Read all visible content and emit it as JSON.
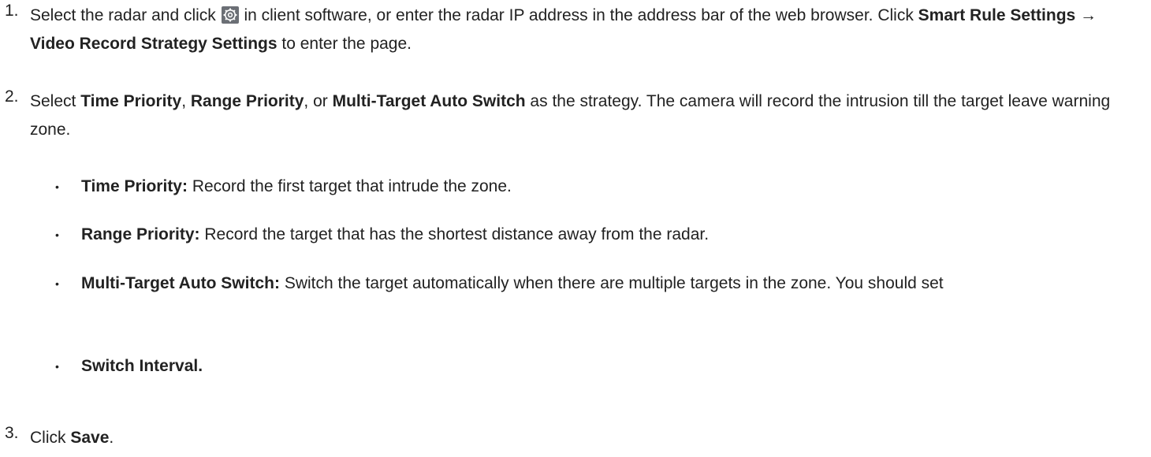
{
  "steps": [
    {
      "number": "1.",
      "text_a": "Select the radar and click ",
      "icon": "settings-gear-icon",
      "text_b": " in client software, or enter the radar IP address in the address bar of the web browser. Click ",
      "bold_a": "Smart Rule Settings → Video Record Strategy Settings",
      "text_c": " to enter the page."
    },
    {
      "number": "2.",
      "text_a": "Select ",
      "bold_a": "Time Priority",
      "text_b": ", ",
      "bold_b": "Range Priority",
      "text_c": ", or ",
      "bold_c": "Multi-Target Auto Switch",
      "text_d": " as the strategy. The camera will record the intrusion till the target leave warning zone."
    },
    {
      "number": "3.",
      "text_a": "Click ",
      "bold_a": "Save",
      "text_b": "."
    }
  ],
  "bullets": [
    {
      "marker": "•",
      "label": "Time Priority:",
      "text": " Record the first target that intrude the zone."
    },
    {
      "marker": "•",
      "label": "Range Priority:",
      "text": " Record the target that has the shortest distance away from the radar."
    },
    {
      "marker": "•",
      "label": "Multi-Target Auto Switch:",
      "text": " Switch the target automatically when there are multiple targets in the zone. You should set"
    },
    {
      "marker": "•",
      "label": "Switch Interval.",
      "text": ""
    }
  ],
  "colors": {
    "text": "#222222",
    "icon_bg": "#6b6f75",
    "icon_fg": "#ffffff"
  }
}
